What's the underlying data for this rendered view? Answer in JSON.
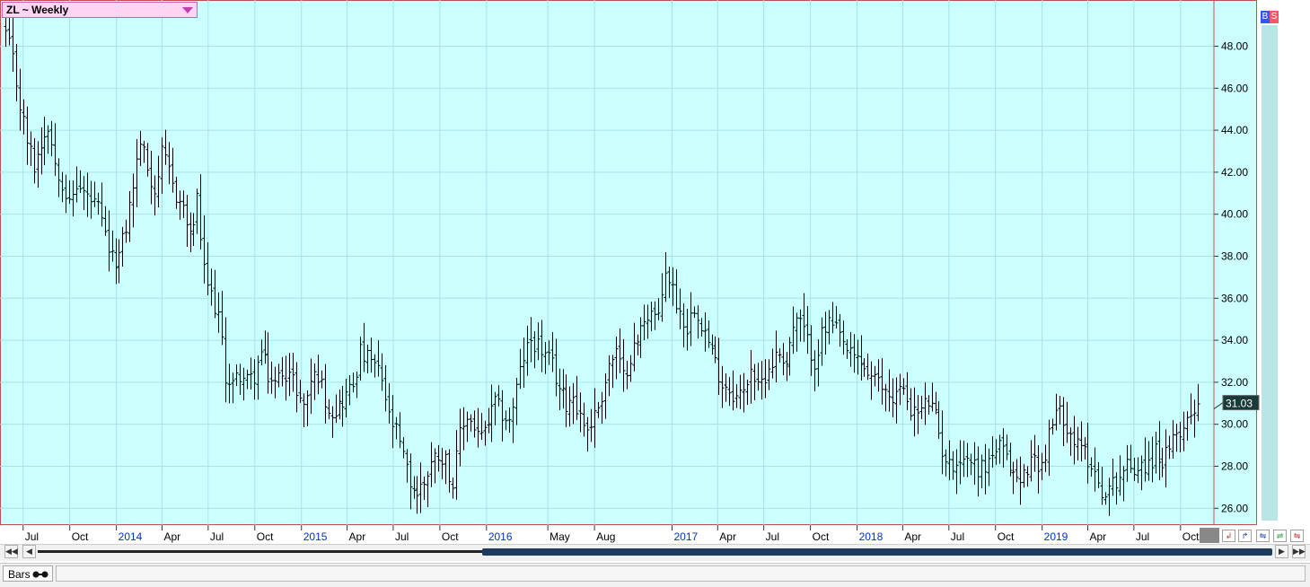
{
  "header": {
    "symbol_label": "ZL ~ Weekly",
    "dropdown_icon": "triangle-down-icon"
  },
  "buttons": {
    "buy_label": "B",
    "sell_label": "S"
  },
  "footer": {
    "tab_label": "Bars",
    "tab_icon": "binoculars-icon"
  },
  "toolbar": {
    "icons": [
      "zoom-out-icon",
      "zoom-in-icon",
      "compress-icon",
      "expand-icon",
      "close-icon"
    ]
  },
  "colors": {
    "background": "#ccffff",
    "grid": "#a8e2e2",
    "bars": "#000000",
    "axis_frame": "#c05050",
    "last_price_bg": "#1a3a3a",
    "year_label": "#0033cc"
  },
  "chart_data": {
    "type": "ohlc",
    "title": "ZL ~ Weekly",
    "period": "weekly",
    "ylim": [
      25.2,
      50.2
    ],
    "grid": true,
    "y_ticks": [
      "26.00",
      "28.00",
      "30.00",
      "32.00",
      "34.00",
      "36.00",
      "38.00",
      "40.00",
      "42.00",
      "44.00",
      "46.00",
      "48.00"
    ],
    "x_ticks": [
      {
        "label": "Jul",
        "date": "2013-07",
        "year": false
      },
      {
        "label": "Oct",
        "date": "2013-10",
        "year": false
      },
      {
        "label": "2014",
        "date": "2014-01",
        "year": true
      },
      {
        "label": "Apr",
        "date": "2014-04",
        "year": false
      },
      {
        "label": "Jul",
        "date": "2014-07",
        "year": false
      },
      {
        "label": "Oct",
        "date": "2014-10",
        "year": false
      },
      {
        "label": "2015",
        "date": "2015-01",
        "year": true
      },
      {
        "label": "Apr",
        "date": "2015-04",
        "year": false
      },
      {
        "label": "Jul",
        "date": "2015-07",
        "year": false
      },
      {
        "label": "Oct",
        "date": "2015-10",
        "year": false
      },
      {
        "label": "2016",
        "date": "2016-01",
        "year": true
      },
      {
        "label": "May",
        "date": "2016-05",
        "year": false
      },
      {
        "label": "Aug",
        "date": "2016-08",
        "year": false
      },
      {
        "label": "2017",
        "date": "2017-01",
        "year": true
      },
      {
        "label": "Apr",
        "date": "2017-04",
        "year": false
      },
      {
        "label": "Jul",
        "date": "2017-07",
        "year": false
      },
      {
        "label": "Oct",
        "date": "2017-10",
        "year": false
      },
      {
        "label": "2018",
        "date": "2018-01",
        "year": true
      },
      {
        "label": "Apr",
        "date": "2018-04",
        "year": false
      },
      {
        "label": "Jul",
        "date": "2018-07",
        "year": false
      },
      {
        "label": "Oct",
        "date": "2018-10",
        "year": false
      },
      {
        "label": "2019",
        "date": "2019-01",
        "year": true
      },
      {
        "label": "Apr",
        "date": "2019-04",
        "year": false
      },
      {
        "label": "Jul",
        "date": "2019-07",
        "year": false
      },
      {
        "label": "Oct",
        "date": "2019-10",
        "year": false
      }
    ],
    "last_price": 31.03,
    "last_price_label": "31.03",
    "close_path": [
      [
        "2013-05-27",
        48.6
      ],
      [
        "2013-06-10",
        47.3
      ],
      [
        "2013-06-24",
        45.2
      ],
      [
        "2013-07-08",
        43.5
      ],
      [
        "2013-07-22",
        42.3
      ],
      [
        "2013-08-05",
        43.4
      ],
      [
        "2013-08-19",
        44.3
      ],
      [
        "2013-09-02",
        42.5
      ],
      [
        "2013-09-16",
        41.6
      ],
      [
        "2013-09-30",
        40.4
      ],
      [
        "2013-10-14",
        41.4
      ],
      [
        "2013-10-28",
        41.0
      ],
      [
        "2013-11-11",
        40.6
      ],
      [
        "2013-11-25",
        40.2
      ],
      [
        "2013-12-09",
        38.9
      ],
      [
        "2013-12-23",
        37.8
      ],
      [
        "2014-01-06",
        38.0
      ],
      [
        "2014-01-20",
        39.4
      ],
      [
        "2014-02-03",
        41.4
      ],
      [
        "2014-02-17",
        43.5
      ],
      [
        "2014-03-03",
        42.2
      ],
      [
        "2014-03-17",
        41.1
      ],
      [
        "2014-03-31",
        42.8
      ],
      [
        "2014-04-14",
        42.0
      ],
      [
        "2014-04-28",
        40.9
      ],
      [
        "2014-05-12",
        40.3
      ],
      [
        "2014-05-26",
        38.8
      ],
      [
        "2014-06-09",
        40.6
      ],
      [
        "2014-06-23",
        37.2
      ],
      [
        "2014-07-07",
        36.1
      ],
      [
        "2014-07-21",
        35.2
      ],
      [
        "2014-08-04",
        32.3
      ],
      [
        "2014-08-18",
        31.9
      ],
      [
        "2014-09-01",
        32.4
      ],
      [
        "2014-09-15",
        32.0
      ],
      [
        "2014-09-29",
        32.3
      ],
      [
        "2014-10-13",
        33.4
      ],
      [
        "2014-10-27",
        32.3
      ],
      [
        "2014-11-10",
        31.9
      ],
      [
        "2014-11-24",
        32.6
      ],
      [
        "2014-12-08",
        32.4
      ],
      [
        "2014-12-22",
        31.7
      ],
      [
        "2015-01-05",
        30.8
      ],
      [
        "2015-01-19",
        32.1
      ],
      [
        "2015-02-02",
        32.4
      ],
      [
        "2015-02-16",
        31.2
      ],
      [
        "2015-03-02",
        30.6
      ],
      [
        "2015-03-16",
        30.9
      ],
      [
        "2015-03-30",
        31.4
      ],
      [
        "2015-04-13",
        31.9
      ],
      [
        "2015-04-27",
        33.4
      ],
      [
        "2015-05-11",
        33.1
      ],
      [
        "2015-05-25",
        32.8
      ],
      [
        "2015-06-08",
        32.1
      ],
      [
        "2015-06-22",
        30.3
      ],
      [
        "2015-07-06",
        29.6
      ],
      [
        "2015-07-20",
        28.4
      ],
      [
        "2015-08-03",
        27.2
      ],
      [
        "2015-08-17",
        26.7
      ],
      [
        "2015-08-31",
        27.3
      ],
      [
        "2015-09-14",
        28.2
      ],
      [
        "2015-09-28",
        28.6
      ],
      [
        "2015-10-12",
        28.3
      ],
      [
        "2015-10-26",
        27.1
      ],
      [
        "2015-11-09",
        29.5
      ],
      [
        "2015-11-23",
        30.4
      ],
      [
        "2015-12-07",
        29.9
      ],
      [
        "2015-12-21",
        29.3
      ],
      [
        "2016-01-04",
        30.1
      ],
      [
        "2016-01-18",
        31.0
      ],
      [
        "2016-02-01",
        30.5
      ],
      [
        "2016-02-15",
        30.1
      ],
      [
        "2016-02-29",
        31.7
      ],
      [
        "2016-03-14",
        33.2
      ],
      [
        "2016-03-28",
        34.0
      ],
      [
        "2016-04-11",
        33.8
      ],
      [
        "2016-04-25",
        33.2
      ],
      [
        "2016-05-09",
        32.8
      ],
      [
        "2016-05-23",
        31.7
      ],
      [
        "2016-06-06",
        31.0
      ],
      [
        "2016-06-20",
        31.4
      ],
      [
        "2016-07-04",
        30.4
      ],
      [
        "2016-07-18",
        29.8
      ],
      [
        "2016-08-01",
        30.4
      ],
      [
        "2016-08-15",
        31.4
      ],
      [
        "2016-08-29",
        32.8
      ],
      [
        "2016-09-12",
        33.4
      ],
      [
        "2016-09-26",
        32.2
      ],
      [
        "2016-10-10",
        33.3
      ],
      [
        "2016-10-24",
        33.9
      ],
      [
        "2016-11-07",
        35.1
      ],
      [
        "2016-11-21",
        35.4
      ],
      [
        "2016-12-05",
        34.9
      ],
      [
        "2016-12-19",
        37.4
      ],
      [
        "2017-01-02",
        36.4
      ],
      [
        "2017-01-16",
        35.3
      ],
      [
        "2017-01-30",
        34.6
      ],
      [
        "2017-02-13",
        35.7
      ],
      [
        "2017-02-27",
        34.9
      ],
      [
        "2017-03-13",
        33.9
      ],
      [
        "2017-03-27",
        32.9
      ],
      [
        "2017-04-10",
        32.0
      ],
      [
        "2017-04-24",
        31.7
      ],
      [
        "2017-05-08",
        31.3
      ],
      [
        "2017-05-22",
        31.5
      ],
      [
        "2017-06-05",
        32.8
      ],
      [
        "2017-06-19",
        31.6
      ],
      [
        "2017-07-03",
        32.4
      ],
      [
        "2017-07-17",
        33.0
      ],
      [
        "2017-07-31",
        33.4
      ],
      [
        "2017-08-14",
        33.0
      ],
      [
        "2017-08-28",
        34.6
      ],
      [
        "2017-09-11",
        34.9
      ],
      [
        "2017-09-25",
        33.9
      ],
      [
        "2017-10-09",
        33.0
      ],
      [
        "2017-10-23",
        34.2
      ],
      [
        "2017-11-06",
        34.8
      ],
      [
        "2017-11-20",
        34.4
      ],
      [
        "2017-12-04",
        33.8
      ],
      [
        "2017-12-18",
        33.2
      ],
      [
        "2018-01-01",
        33.1
      ],
      [
        "2018-01-15",
        32.7
      ],
      [
        "2018-01-29",
        32.2
      ],
      [
        "2018-02-12",
        31.9
      ],
      [
        "2018-02-26",
        31.6
      ],
      [
        "2018-03-12",
        31.3
      ],
      [
        "2018-03-26",
        31.7
      ],
      [
        "2018-04-09",
        31.2
      ],
      [
        "2018-04-23",
        30.5
      ],
      [
        "2018-05-07",
        30.7
      ],
      [
        "2018-05-21",
        31.1
      ],
      [
        "2018-06-04",
        30.3
      ],
      [
        "2018-06-18",
        28.8
      ],
      [
        "2018-07-02",
        28.0
      ],
      [
        "2018-07-16",
        28.3
      ],
      [
        "2018-07-30",
        28.4
      ],
      [
        "2018-08-13",
        28.3
      ],
      [
        "2018-08-27",
        27.9
      ],
      [
        "2018-09-10",
        28.0
      ],
      [
        "2018-09-24",
        28.6
      ],
      [
        "2018-10-08",
        28.9
      ],
      [
        "2018-10-22",
        28.3
      ],
      [
        "2018-11-05",
        27.7
      ],
      [
        "2018-11-19",
        27.2
      ],
      [
        "2018-12-03",
        28.0
      ],
      [
        "2018-12-17",
        28.4
      ],
      [
        "2018-12-31",
        28.0
      ],
      [
        "2019-01-14",
        29.4
      ],
      [
        "2019-01-28",
        30.6
      ],
      [
        "2019-02-11",
        30.4
      ],
      [
        "2019-02-25",
        29.6
      ],
      [
        "2019-03-11",
        28.9
      ],
      [
        "2019-03-25",
        28.7
      ],
      [
        "2019-04-08",
        28.1
      ],
      [
        "2019-04-22",
        27.3
      ],
      [
        "2019-05-06",
        26.5
      ],
      [
        "2019-05-20",
        27.2
      ],
      [
        "2019-06-03",
        27.6
      ],
      [
        "2019-06-17",
        28.0
      ],
      [
        "2019-07-01",
        27.9
      ],
      [
        "2019-07-15",
        28.2
      ],
      [
        "2019-07-29",
        28.0
      ],
      [
        "2019-08-12",
        28.7
      ],
      [
        "2019-08-26",
        28.3
      ],
      [
        "2019-09-09",
        28.6
      ],
      [
        "2019-09-23",
        29.6
      ],
      [
        "2019-10-07",
        29.9
      ],
      [
        "2019-10-21",
        30.6
      ],
      [
        "2019-11-04",
        31.1
      ]
    ]
  }
}
